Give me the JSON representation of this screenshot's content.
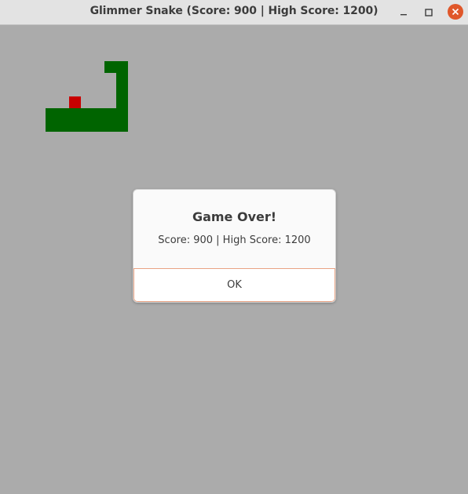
{
  "window": {
    "title": "Glimmer Snake (Score: 900 | High Score: 1200)"
  },
  "game": {
    "score": 900,
    "high_score": 1200,
    "snake_color": "#006400",
    "food_color": "#c80000",
    "board_color": "#ababab"
  },
  "dialog": {
    "title": "Game Over!",
    "message": "Score: 900 | High Score: 1200",
    "ok_label": "OK"
  },
  "icons": {
    "minimize": "minimize-icon",
    "maximize": "maximize-icon",
    "close": "close-icon"
  }
}
